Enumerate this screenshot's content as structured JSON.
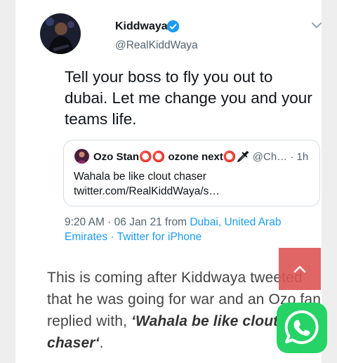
{
  "tweet": {
    "author_name": "Kiddwaya",
    "author_handle": "@RealKiddWaya",
    "text": "Tell your boss to fly you out to dubai. Let me change you and your teams life.",
    "quote": {
      "author_name": "Ozo Stan⭕⭕ ozone next⭕🗡",
      "author_handle": "@Ch…",
      "sep": "·",
      "time": "1h",
      "text": "Wahala be like clout chaser twitter.com/RealKiddWaya/s…"
    },
    "meta": {
      "time_date": "9:20 AM · 06 Jan 21 from ",
      "location": "Dubai, United Arab Emirates",
      "sep": " · ",
      "source": "Twitter for iPhone"
    }
  },
  "article": {
    "text_before": "This is coming after Kiddwaya tweeted that he was going for war and an Ozo fan replied with, ",
    "quote_text": "‘Wahala be like clout chaser‘",
    "text_after": "."
  },
  "colors": {
    "link": "#1d9bf0",
    "verified": "#1d9bf0",
    "scroll_top_button": "#dd5454",
    "whatsapp": "#25d366"
  },
  "icons": {
    "verified": "verified-badge-icon",
    "chevron": "chevron-down-icon",
    "scroll_top": "chevron-up-icon",
    "whatsapp": "whatsapp-icon"
  }
}
